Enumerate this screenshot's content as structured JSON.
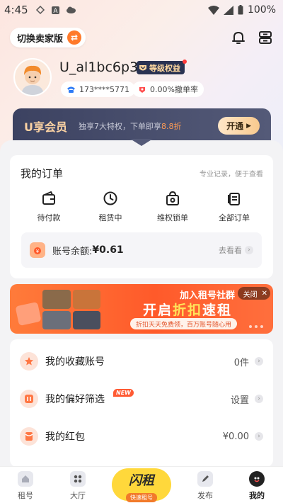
{
  "status_bar": {
    "time": "4:45",
    "battery": "100%"
  },
  "header": {
    "switch_label": "切换卖家版"
  },
  "profile": {
    "username": "U_al1bc6p3",
    "badge": "等级权益",
    "phone": "173****5771",
    "cancel_rate": "0.00%撤单率"
  },
  "vip": {
    "title": "U享会员",
    "desc_prefix": "独享7大特权，下单即享",
    "desc_highlight": "8.8折",
    "button": "开通"
  },
  "orders": {
    "title": "我的订单",
    "subtitle": "专业记录，便于查看",
    "items": [
      {
        "label": "待付款",
        "icon": "wallet-icon"
      },
      {
        "label": "租赁中",
        "icon": "clock-icon"
      },
      {
        "label": "维权锁单",
        "icon": "lock-bag-icon"
      },
      {
        "label": "全部订单",
        "icon": "document-icon"
      }
    ],
    "balance_label": "账号余额:",
    "balance_value": "¥0.61",
    "balance_link": "去看看"
  },
  "promo": {
    "line1": "加入租号社群",
    "line2_a": "开启",
    "line2_b": "折扣",
    "line2_c": "速租",
    "line3": "折扣天天免费领，百万账号随心用",
    "close": "关闭"
  },
  "menu": [
    {
      "label": "我的收藏账号",
      "value": "0件",
      "icon": "star-icon"
    },
    {
      "label": "我的偏好筛选",
      "value": "设置",
      "icon": "filter-icon",
      "tag": "NEW"
    },
    {
      "label": "我的红包",
      "value": "¥0.00",
      "icon": "red-packet-icon"
    }
  ],
  "nav": {
    "items": [
      {
        "label": "租号",
        "icon": "home-icon"
      },
      {
        "label": "大厅",
        "icon": "grid-icon"
      },
      {
        "label": "发布",
        "icon": "edit-icon"
      },
      {
        "label": "我的",
        "icon": "profile-icon"
      }
    ],
    "center_big": "闪租",
    "center_small": "快速租号"
  },
  "colors": {
    "accent": "#ff7a2b",
    "vip_bg": "#3c4261",
    "brand_yellow": "#ffd83b"
  }
}
